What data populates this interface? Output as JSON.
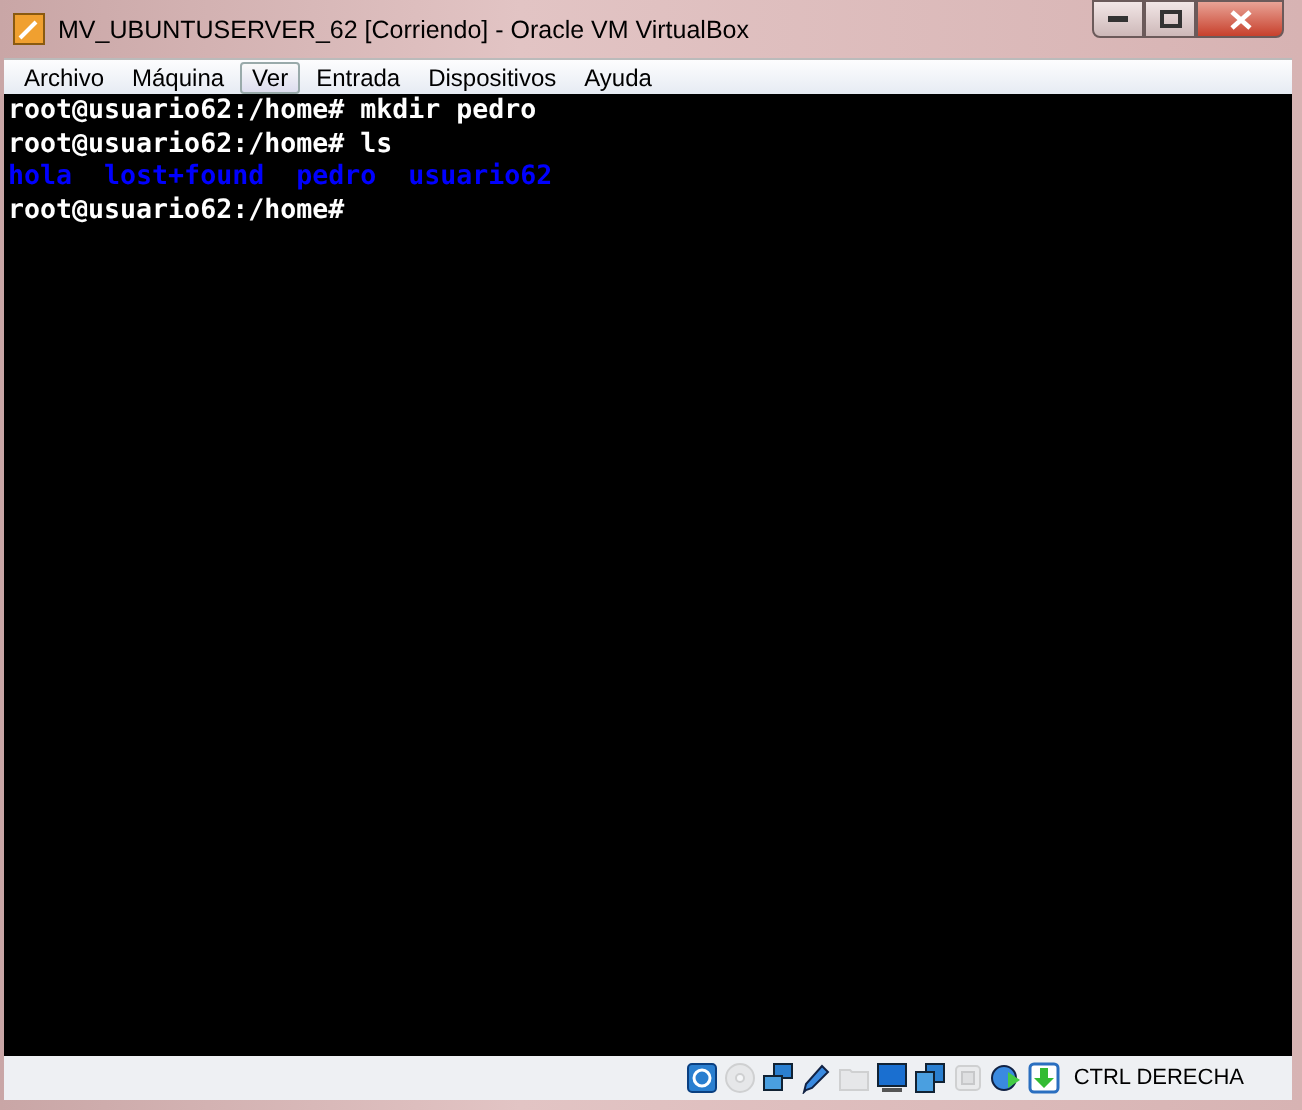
{
  "window": {
    "title": "MV_UBUNTUSERVER_62 [Corriendo] - Oracle VM VirtualBox"
  },
  "menu": [
    {
      "label": "Archivo",
      "selected": false
    },
    {
      "label": "Máquina",
      "selected": false
    },
    {
      "label": "Ver",
      "selected": true
    },
    {
      "label": "Entrada",
      "selected": false
    },
    {
      "label": "Dispositivos",
      "selected": false
    },
    {
      "label": "Ayuda",
      "selected": false
    }
  ],
  "terminal": {
    "lines": [
      {
        "kind": "command",
        "text": "root@usuario62:/home# mkdir pedro"
      },
      {
        "kind": "command",
        "text": "root@usuario62:/home# ls"
      },
      {
        "kind": "listing",
        "items": [
          {
            "name": "hola",
            "color": "#0000ff"
          },
          {
            "name": "lost+found",
            "color": "#0000ff"
          },
          {
            "name": "pedro",
            "color": "#0000ff"
          },
          {
            "name": "usuario62",
            "color": "#0000ff"
          }
        ]
      },
      {
        "kind": "command",
        "text": "root@usuario62:/home#"
      }
    ]
  },
  "status_bar": {
    "devices": [
      {
        "disabled": false
      },
      {
        "disabled": true
      },
      {
        "disabled": false
      },
      {
        "disabled": false
      },
      {
        "disabled": true
      },
      {
        "disabled": false
      },
      {
        "disabled": false
      },
      {
        "disabled": true
      },
      {
        "disabled": false
      },
      {
        "disabled": false
      }
    ],
    "host_key": "CTRL DERECHA"
  }
}
